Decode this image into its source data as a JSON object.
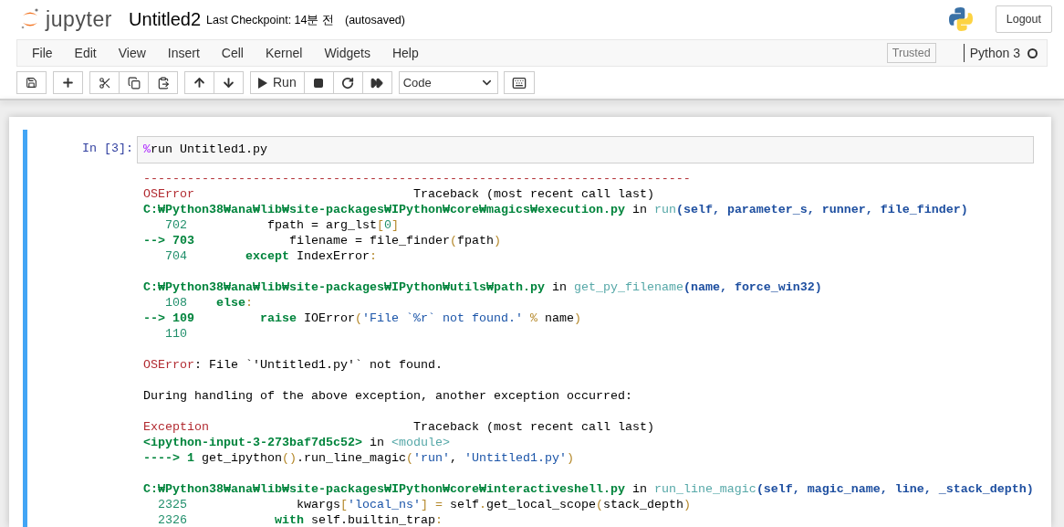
{
  "header": {
    "logo_text": "jupyter",
    "notebook_name": "Untitled2",
    "checkpoint": "Last Checkpoint: 14분 전",
    "autosave": "(autosaved)",
    "logout": "Logout"
  },
  "menu": {
    "items": [
      "File",
      "Edit",
      "View",
      "Insert",
      "Cell",
      "Kernel",
      "Widgets",
      "Help"
    ],
    "trusted": "Trusted",
    "kernel_name": "Python 3",
    "kernel_busy": false
  },
  "toolbar": {
    "run_label": "Run",
    "cell_type": "Code"
  },
  "cell": {
    "selected": true,
    "prompt": "In [3]:",
    "input": [
      {
        "kind": "magic",
        "text": "%"
      },
      {
        "kind": "plain",
        "text": "run Untitled1.py"
      }
    ],
    "output": [
      [
        [
          {
            "kind": "rule",
            "text": "---------------------------------------------------------------------------"
          }
        ],
        [
          {
            "kind": "ename",
            "text": "OSError"
          },
          {
            "kind": "plain",
            "text": "                              Traceback (most recent call last)"
          }
        ],
        [
          {
            "kind": "path",
            "text": "C:₩Python38₩ana₩lib₩site-packages₩IPython₩core₩magics₩execution.py"
          },
          {
            "kind": "plain",
            "text": " in "
          },
          {
            "kind": "func",
            "text": "run"
          },
          {
            "kind": "args",
            "text": "(self, parameter_s, runner, file_finder)"
          }
        ],
        [
          {
            "kind": "lineno",
            "text": "   702"
          },
          {
            "kind": "plain",
            "text": "           fpath = arg_lst"
          },
          {
            "kind": "paren",
            "text": "["
          },
          {
            "kind": "number",
            "text": "0"
          },
          {
            "kind": "paren",
            "text": "]"
          }
        ],
        [
          {
            "kind": "arrow",
            "text": "--> 703"
          },
          {
            "kind": "plain",
            "text": "             filename = file_finder"
          },
          {
            "kind": "paren",
            "text": "("
          },
          {
            "kind": "plain",
            "text": "fpath"
          },
          {
            "kind": "paren",
            "text": ")"
          }
        ],
        [
          {
            "kind": "lineno",
            "text": "   704"
          },
          {
            "kind": "keyword",
            "text": "        except"
          },
          {
            "kind": "plain",
            "text": " IndexError"
          },
          {
            "kind": "paren",
            "text": ":"
          }
        ]
      ],
      [
        [
          {
            "kind": "path",
            "text": "C:₩Python38₩ana₩lib₩site-packages₩IPython₩utils₩path.py"
          },
          {
            "kind": "plain",
            "text": " in "
          },
          {
            "kind": "func",
            "text": "get_py_filename"
          },
          {
            "kind": "args",
            "text": "(name, force_win32)"
          }
        ],
        [
          {
            "kind": "lineno",
            "text": "   108"
          },
          {
            "kind": "keyword",
            "text": "    else"
          },
          {
            "kind": "paren",
            "text": ":"
          }
        ],
        [
          {
            "kind": "arrow",
            "text": "--> 109"
          },
          {
            "kind": "keyword",
            "text": "         raise"
          },
          {
            "kind": "plain",
            "text": " IOError"
          },
          {
            "kind": "paren",
            "text": "("
          },
          {
            "kind": "string",
            "text": "'File `%r` not found.' "
          },
          {
            "kind": "paren",
            "text": "%"
          },
          {
            "kind": "plain",
            "text": " name"
          },
          {
            "kind": "paren",
            "text": ")"
          }
        ],
        [
          {
            "kind": "lineno",
            "text": "   110"
          }
        ]
      ],
      [
        [
          {
            "kind": "ename",
            "text": "OSError"
          },
          {
            "kind": "plain",
            "text": ": File `'Untitled1.py'` not found."
          }
        ]
      ],
      [
        [
          {
            "kind": "plain",
            "text": "During handling of the above exception, another exception occurred:"
          }
        ]
      ],
      [
        [
          {
            "kind": "ename",
            "text": "Exception"
          },
          {
            "kind": "plain",
            "text": "                            Traceback (most recent call last)"
          }
        ],
        [
          {
            "kind": "path",
            "text": "<ipython-input-3-273baf7d5c52>"
          },
          {
            "kind": "plain",
            "text": " in "
          },
          {
            "kind": "func",
            "text": "<module>"
          }
        ],
        [
          {
            "kind": "arrow",
            "text": "----> 1"
          },
          {
            "kind": "plain",
            "text": " get_ipython"
          },
          {
            "kind": "paren",
            "text": "()"
          },
          {
            "kind": "plain",
            "text": ".run_line_magic"
          },
          {
            "kind": "paren",
            "text": "("
          },
          {
            "kind": "string",
            "text": "'run'"
          },
          {
            "kind": "plain",
            "text": ", "
          },
          {
            "kind": "string",
            "text": "'Untitled1.py'"
          },
          {
            "kind": "paren",
            "text": ")"
          }
        ]
      ],
      [
        [
          {
            "kind": "path",
            "text": "C:₩Python38₩ana₩lib₩site-packages₩IPython₩core₩interactiveshell.py"
          },
          {
            "kind": "plain",
            "text": " in "
          },
          {
            "kind": "func",
            "text": "run_line_magic"
          },
          {
            "kind": "args",
            "text": "(self, magic_name, line, _stack_depth)"
          }
        ],
        [
          {
            "kind": "lineno",
            "text": "  2325"
          },
          {
            "kind": "plain",
            "text": "               kwargs"
          },
          {
            "kind": "paren",
            "text": "["
          },
          {
            "kind": "string",
            "text": "'local_ns'"
          },
          {
            "kind": "paren",
            "text": "] ="
          },
          {
            "kind": "plain",
            "text": " self"
          },
          {
            "kind": "paren",
            "text": "."
          },
          {
            "kind": "plain",
            "text": "get_local_scope"
          },
          {
            "kind": "paren",
            "text": "("
          },
          {
            "kind": "plain",
            "text": "stack_depth"
          },
          {
            "kind": "paren",
            "text": ")"
          }
        ],
        [
          {
            "kind": "lineno",
            "text": "  2326"
          },
          {
            "kind": "keyword",
            "text": "            with"
          },
          {
            "kind": "plain",
            "text": " self.builtin_trap"
          },
          {
            "kind": "paren",
            "text": ":"
          }
        ]
      ]
    ]
  }
}
